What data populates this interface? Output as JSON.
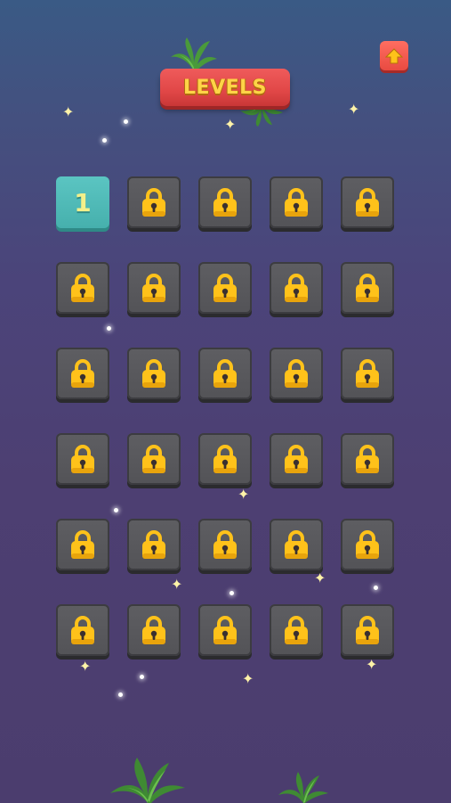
{
  "header": {
    "title": "LEVELS",
    "home_icon": "home-arrow-up-icon"
  },
  "levels": {
    "columns": 5,
    "rows": 6,
    "tiles": [
      {
        "label": "1",
        "state": "unlocked"
      },
      {
        "state": "locked"
      },
      {
        "state": "locked"
      },
      {
        "state": "locked"
      },
      {
        "state": "locked"
      },
      {
        "state": "locked"
      },
      {
        "state": "locked"
      },
      {
        "state": "locked"
      },
      {
        "state": "locked"
      },
      {
        "state": "locked"
      },
      {
        "state": "locked"
      },
      {
        "state": "locked"
      },
      {
        "state": "locked"
      },
      {
        "state": "locked"
      },
      {
        "state": "locked"
      },
      {
        "state": "locked"
      },
      {
        "state": "locked"
      },
      {
        "state": "locked"
      },
      {
        "state": "locked"
      },
      {
        "state": "locked"
      },
      {
        "state": "locked"
      },
      {
        "state": "locked"
      },
      {
        "state": "locked"
      },
      {
        "state": "locked"
      },
      {
        "state": "locked"
      },
      {
        "state": "locked"
      },
      {
        "state": "locked"
      },
      {
        "state": "locked"
      },
      {
        "state": "locked"
      },
      {
        "state": "locked"
      }
    ],
    "lock_icon": "padlock-icon"
  },
  "colors": {
    "title_banner": "#e14747",
    "title_text": "#ffd447",
    "unlocked_tile": "#4fb9b6",
    "locked_tile": "#59595d",
    "padlock": "#ffc21a"
  }
}
